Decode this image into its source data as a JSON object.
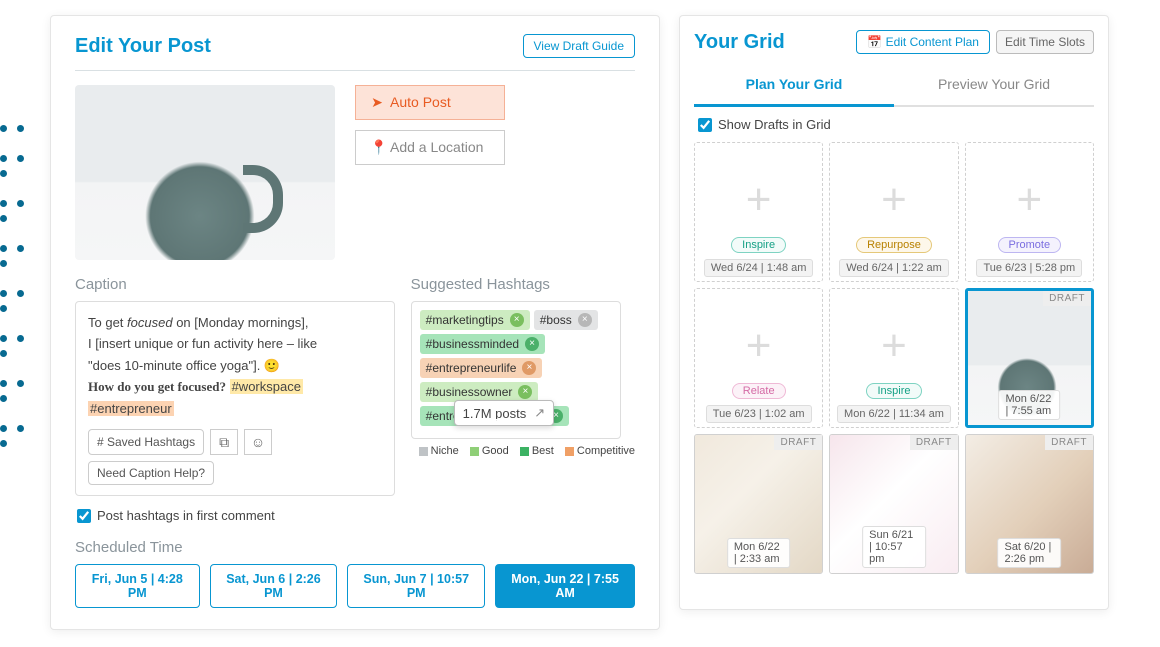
{
  "left": {
    "title": "Edit Your Post",
    "view_draft": "View Draft Guide",
    "auto_post": "Auto Post",
    "add_location": "Add a Location",
    "caption_label": "Caption",
    "suggested_label": "Suggested Hashtags",
    "caption": {
      "l1a": "To get ",
      "l1b": "focused",
      "l1c": " on [Monday mornings],",
      "l2": "I [insert unique or fun activity here – like",
      "l3": "\"does 10-minute office yoga\"]. 🙂",
      "l4a": "How do you get focused?",
      "l4b": "#workspace",
      "l4c": "#entrepreneur"
    },
    "tools": {
      "saved_hashtags": "# Saved Hashtags",
      "caption_help": "Need Caption Help?"
    },
    "hashtags": {
      "row1a": "#marketingtips",
      "row1b": "#boss",
      "row2": "#businessminded",
      "row3": "#entrepreneurlife",
      "row4": "#businessowner",
      "row5": "#entrepreneurmindset",
      "tooltip": "1.7M posts"
    },
    "legend": {
      "niche": "Niche",
      "good": "Good",
      "best": "Best",
      "comp": "Competitive"
    },
    "first_comment": "Post hashtags in first comment",
    "sched_label": "Scheduled Time",
    "times": [
      "Fri, Jun 5 | 4:28 PM",
      "Sat, Jun 6 | 2:26 PM",
      "Sun, Jun 7 | 10:57 PM",
      "Mon, Jun 22 | 7:55 AM"
    ]
  },
  "right": {
    "title": "Your Grid",
    "edit_plan": "Edit Content Plan",
    "edit_slots": "Edit Time Slots",
    "tab_plan": "Plan Your Grid",
    "tab_preview": "Preview Your Grid",
    "show_drafts": "Show Drafts in Grid",
    "draft": "DRAFT",
    "cells": {
      "c0": {
        "pill": "Inspire",
        "time": "Wed 6/24 | 1:48 am"
      },
      "c1": {
        "pill": "Repurpose",
        "time": "Wed 6/24 | 1:22 am"
      },
      "c2": {
        "pill": "Promote",
        "time": "Tue 6/23 | 5:28 pm"
      },
      "c3": {
        "pill": "Relate",
        "time": "Tue 6/23 | 1:02 am"
      },
      "c4": {
        "pill": "Inspire",
        "time": "Mon 6/22 | 11:34 am"
      },
      "c5": {
        "time": "Mon 6/22 | 7:55 am"
      },
      "c6": {
        "time": "Mon 6/22 | 2:33 am"
      },
      "c7": {
        "time": "Sun 6/21 | 10:57 pm"
      },
      "c8": {
        "time": "Sat 6/20 | 2:26 pm"
      }
    }
  }
}
